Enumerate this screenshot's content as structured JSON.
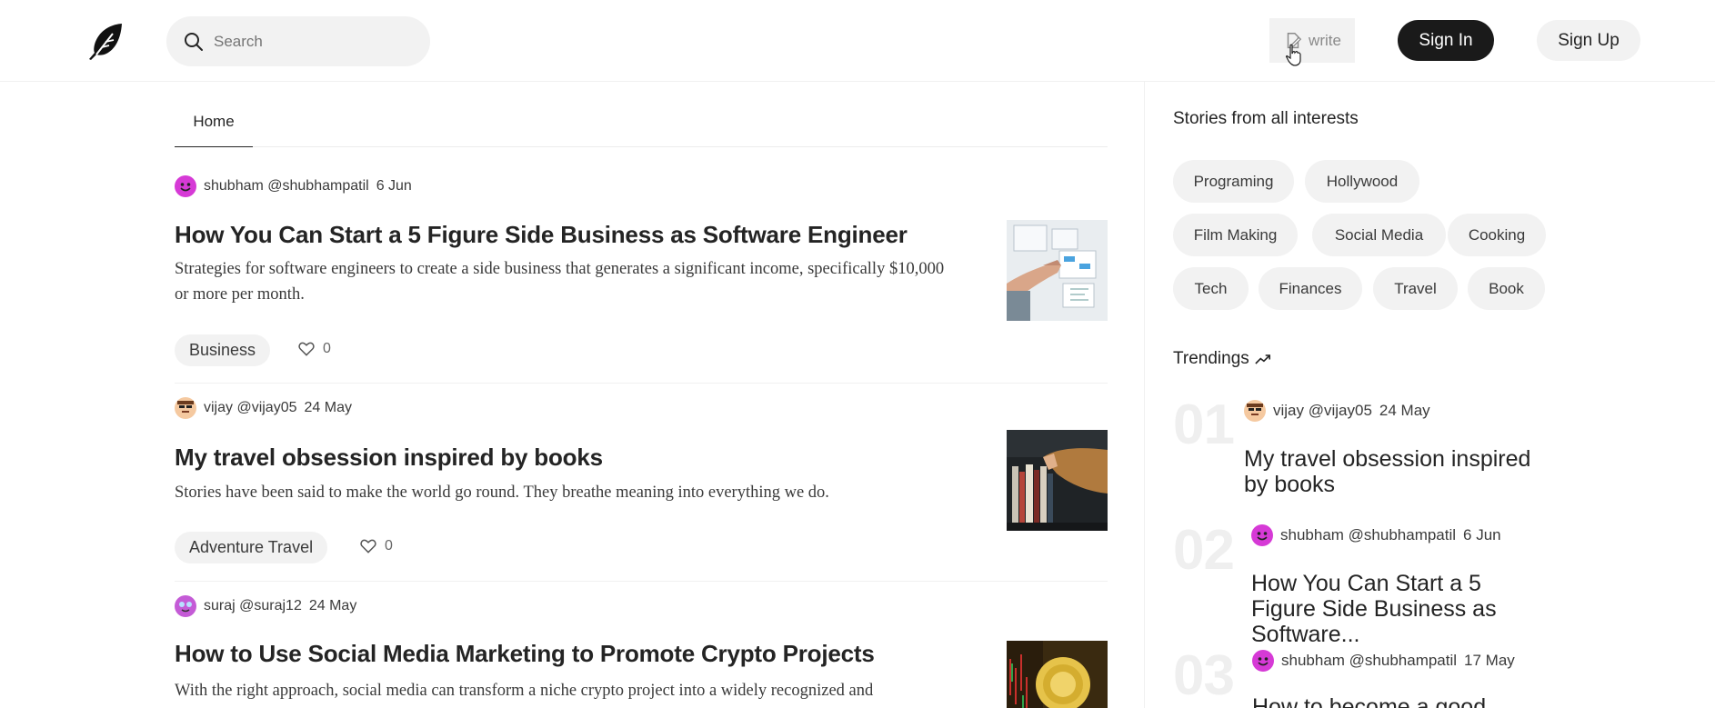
{
  "header": {
    "search_placeholder": "Search",
    "write_label": "write",
    "signin_label": "Sign In",
    "signup_label": "Sign Up"
  },
  "tabs": [
    {
      "label": "Home",
      "active": true
    }
  ],
  "articles": [
    {
      "author": "shubham @shubhampatil",
      "date": "6 Jun",
      "title": "How You Can Start a 5 Figure Side Business as Software Engineer",
      "description": "Strategies for software engineers to create a side business that generates a significant income, specifically $10,000 or more per month.",
      "tag": "Business",
      "likes": "0"
    },
    {
      "author": "vijay @vijay05",
      "date": "24 May",
      "title": "My travel obsession inspired by books",
      "description": "Stories have been said to make the world go round. They breathe meaning into everything we do.",
      "tag": "Adventure Travel",
      "likes": "0"
    },
    {
      "author": "suraj @suraj12",
      "date": "24 May",
      "title": "How to Use Social Media Marketing to Promote Crypto Projects",
      "description": "With the right approach, social media can transform a niche crypto project into a widely recognized and"
    }
  ],
  "sidebar": {
    "interests_title": "Stories from all interests",
    "interests": [
      "Programing",
      "Hollywood",
      "Film Making",
      "Social Media",
      "Cooking",
      "Tech",
      "Finances",
      "Travel",
      "Book"
    ],
    "trendings_title": "Trendings",
    "trendings": [
      {
        "num": "01",
        "author": "vijay @vijay05",
        "date": "24 May",
        "title": "My travel obsession inspired by books"
      },
      {
        "num": "02",
        "author": "shubham @shubhampatil",
        "date": "6 Jun",
        "title": "How You Can Start a 5 Figure Side Business as Software..."
      },
      {
        "num": "03",
        "author": "shubham @shubhampatil",
        "date": "17 May",
        "title": "How to become a good"
      }
    ]
  },
  "colors": {
    "primary_button": "#1a1a1a",
    "chip_bg": "#f2f2f2",
    "avatar_pink": "#d63ad6"
  }
}
